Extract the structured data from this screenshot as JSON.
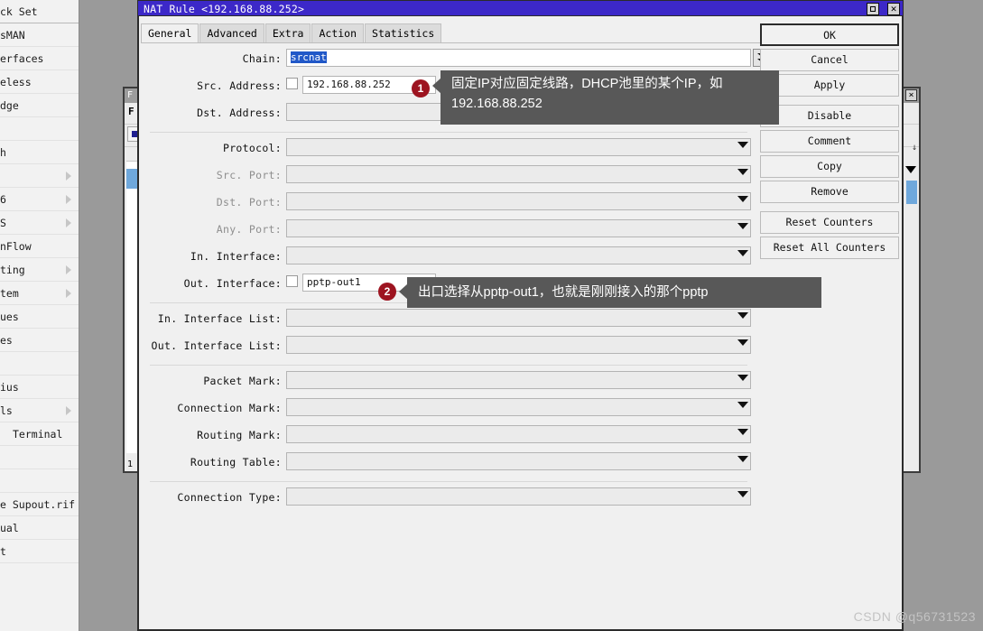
{
  "sidebar": {
    "items": [
      {
        "label": "ck Set",
        "arrow": false,
        "first": true
      },
      {
        "label": "sMAN",
        "arrow": false
      },
      {
        "label": "erfaces",
        "arrow": false
      },
      {
        "label": "eless",
        "arrow": false
      },
      {
        "label": "dge",
        "arrow": false
      },
      {
        "label": "",
        "arrow": false,
        "blank": true
      },
      {
        "label": "h",
        "arrow": false
      },
      {
        "label": "",
        "arrow": true,
        "blank": true
      },
      {
        "label": "6",
        "arrow": true
      },
      {
        "label": "S",
        "arrow": true
      },
      {
        "label": "nFlow",
        "arrow": false
      },
      {
        "label": "ting",
        "arrow": true
      },
      {
        "label": "tem",
        "arrow": true
      },
      {
        "label": "ues",
        "arrow": false
      },
      {
        "label": "es",
        "arrow": false
      },
      {
        "label": "",
        "arrow": false,
        "blank": true
      },
      {
        "label": "ius",
        "arrow": false
      },
      {
        "label": "ls",
        "arrow": true
      },
      {
        "label": "Terminal",
        "arrow": false,
        "indent": true
      },
      {
        "label": "",
        "arrow": false,
        "blank": true
      },
      {
        "label": "",
        "arrow": false,
        "blank": true
      },
      {
        "label": "e Supout.rif",
        "arrow": false
      },
      {
        "label": "ual",
        "arrow": false,
        "underline": true
      },
      {
        "label": "t",
        "arrow": false
      }
    ]
  },
  "background_window": {
    "title": "F",
    "tab_label": "F",
    "close_label": "×",
    "status_number": "1",
    "right_glyph": "↓"
  },
  "dialog": {
    "title": "NAT Rule <192.168.88.252>",
    "window_buttons": {
      "maximize": "□",
      "close": "✕"
    },
    "tabs": [
      {
        "label": "General",
        "active": true
      },
      {
        "label": "Advanced",
        "active": false
      },
      {
        "label": "Extra",
        "active": false
      },
      {
        "label": "Action",
        "active": false
      },
      {
        "label": "Statistics",
        "active": false
      }
    ],
    "fields": [
      {
        "label": "Chain:",
        "value": "srcnat",
        "type": "chain",
        "dim": false,
        "checkbox": false,
        "selected": true
      },
      {
        "label": "Src. Address:",
        "value": "192.168.88.252",
        "type": "short",
        "dim": false,
        "checkbox": true
      },
      {
        "label": "Dst. Address:",
        "value": "",
        "type": "combo",
        "dim": false,
        "checkbox": false
      },
      {
        "divider": true
      },
      {
        "label": "Protocol:",
        "value": "",
        "type": "combo",
        "dim": false,
        "checkbox": false
      },
      {
        "label": "Src. Port:",
        "value": "",
        "type": "combo",
        "dim": true,
        "checkbox": false
      },
      {
        "label": "Dst. Port:",
        "value": "",
        "type": "combo",
        "dim": true,
        "checkbox": false
      },
      {
        "label": "Any. Port:",
        "value": "",
        "type": "combo",
        "dim": true,
        "checkbox": false
      },
      {
        "label": "In. Interface:",
        "value": "",
        "type": "combo",
        "dim": false,
        "checkbox": false
      },
      {
        "label": "Out. Interface:",
        "value": "pptp-out1",
        "type": "short",
        "dim": false,
        "checkbox": true
      },
      {
        "divider": true
      },
      {
        "label": "In. Interface List:",
        "value": "",
        "type": "combo",
        "dim": false,
        "checkbox": false
      },
      {
        "label": "Out. Interface List:",
        "value": "",
        "type": "combo",
        "dim": false,
        "checkbox": false
      },
      {
        "divider": true
      },
      {
        "label": "Packet Mark:",
        "value": "",
        "type": "combo",
        "dim": false,
        "checkbox": false
      },
      {
        "label": "Connection Mark:",
        "value": "",
        "type": "combo",
        "dim": false,
        "checkbox": false
      },
      {
        "label": "Routing Mark:",
        "value": "",
        "type": "combo",
        "dim": false,
        "checkbox": false
      },
      {
        "label": "Routing Table:",
        "value": "",
        "type": "combo",
        "dim": false,
        "checkbox": false
      },
      {
        "divider": true
      },
      {
        "label": "Connection Type:",
        "value": "",
        "type": "combo",
        "dim": false,
        "checkbox": false
      }
    ],
    "buttons": [
      {
        "label": "OK",
        "primary": true,
        "gap": false
      },
      {
        "label": "Cancel",
        "primary": false,
        "gap": false
      },
      {
        "label": "Apply",
        "primary": false,
        "gap": false
      },
      {
        "label": "Disable",
        "primary": false,
        "gap": true
      },
      {
        "label": "Comment",
        "primary": false,
        "gap": false
      },
      {
        "label": "Copy",
        "primary": false,
        "gap": false
      },
      {
        "label": "Remove",
        "primary": false,
        "gap": false
      },
      {
        "label": "Reset Counters",
        "primary": false,
        "gap": true
      },
      {
        "label": "Reset All Counters",
        "primary": false,
        "gap": false
      }
    ]
  },
  "annotations": [
    {
      "number": "1",
      "text": "固定IP对应固定线路，DHCP池里的某个IP，如192.168.88.252"
    },
    {
      "number": "2",
      "text": "出口选择从pptp-out1，也就是刚刚接入的那个pptp"
    }
  ],
  "watermark": "CSDN @q56731523",
  "colors": {
    "titlebar": "#3c28c8",
    "desktop": "#9a9a9a",
    "badge": "#9d1420",
    "tooltip": "#585858",
    "selection": "#2158c8"
  }
}
